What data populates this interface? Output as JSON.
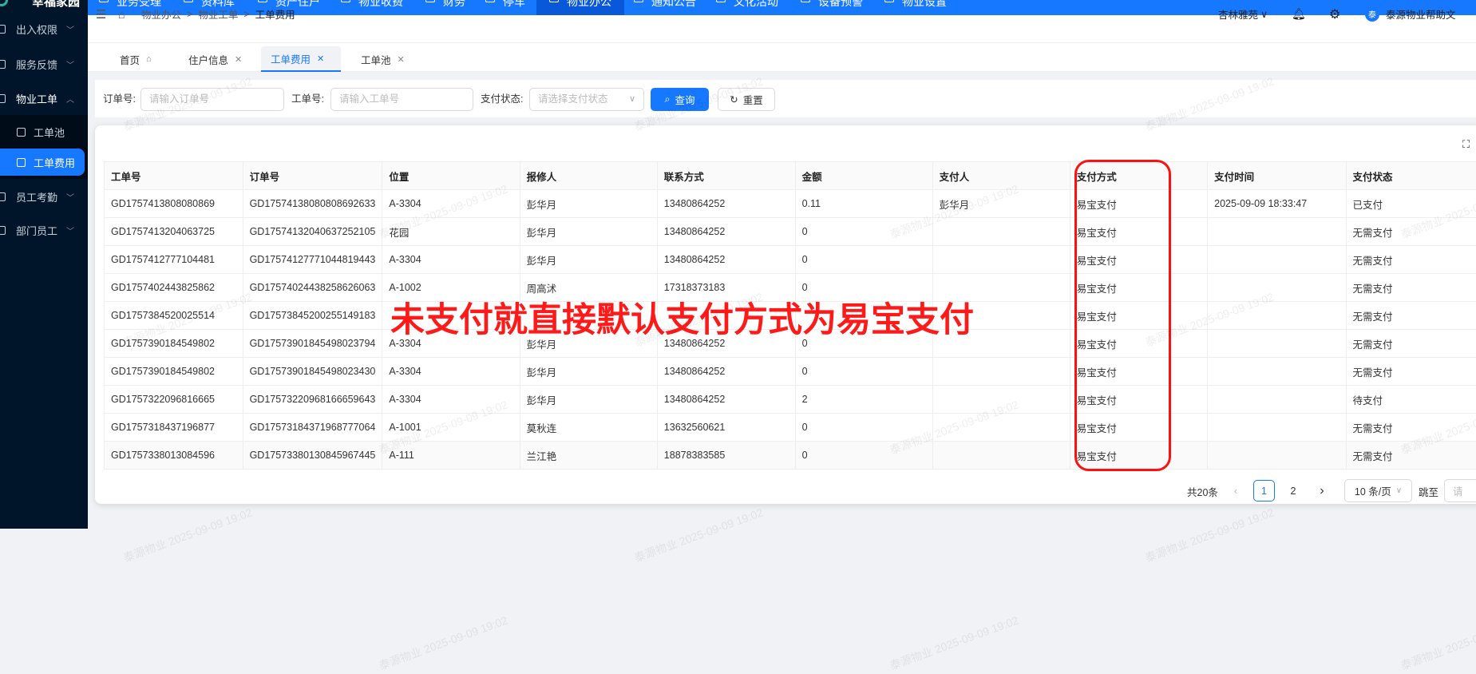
{
  "app": {
    "logo_text": "幸福家园"
  },
  "topnav": [
    {
      "label": "业务受理",
      "icon": "form-icon"
    },
    {
      "label": "资料库",
      "icon": "file-icon"
    },
    {
      "label": "资产住户",
      "icon": "bank-icon"
    },
    {
      "label": "物业收费",
      "icon": "money-icon"
    },
    {
      "label": "财务",
      "icon": "finance-icon"
    },
    {
      "label": "停车",
      "icon": "car-icon"
    },
    {
      "label": "物业办公",
      "icon": "office-icon",
      "active": true
    },
    {
      "label": "通知公告",
      "icon": "notice-icon"
    },
    {
      "label": "文化活动",
      "icon": "activity-icon"
    },
    {
      "label": "设备预警",
      "icon": "device-icon"
    },
    {
      "label": "物业设置",
      "icon": "setting-icon"
    }
  ],
  "sidebar": {
    "items": [
      {
        "label": "出入权限"
      },
      {
        "label": "服务反馈"
      },
      {
        "label": "物业工单"
      },
      {
        "label": "工单池"
      },
      {
        "label": "工单费用"
      },
      {
        "label": "员工考勤"
      },
      {
        "label": "部门员工"
      }
    ]
  },
  "breadcrumb": [
    "物业办公",
    "物业工单",
    "工单费用"
  ],
  "header": {
    "community": "杏林雅苑",
    "avatar_char": "泰",
    "user": "泰源物业",
    "help": "帮助文"
  },
  "tabs": [
    {
      "label": "首页"
    },
    {
      "label": "住户信息"
    },
    {
      "label": "工单费用",
      "active": true
    },
    {
      "label": "工单池"
    }
  ],
  "filter": {
    "order_label": "订单号:",
    "order_placeholder": "请输入订单号",
    "ticket_label": "工单号:",
    "ticket_placeholder": "请输入工单号",
    "status_label": "支付状态:",
    "status_placeholder": "请选择支付状态",
    "search": "查询",
    "reset": "重置"
  },
  "table": {
    "columns": [
      "工单号",
      "订单号",
      "位置",
      "报修人",
      "联系方式",
      "金额",
      "支付人",
      "支付方式",
      "支付时间",
      "支付状态"
    ],
    "rows": [
      [
        "GD1757413808080869",
        "GD17574138080808692633",
        "A-3304",
        "彭华月",
        "13480864252",
        "0.11",
        "彭华月",
        "易宝支付",
        "2025-09-09 18:33:47",
        "已支付"
      ],
      [
        "GD1757413204063725",
        "GD17574132040637252105",
        "花园",
        "彭华月",
        "13480864252",
        "0",
        "",
        "易宝支付",
        "",
        "无需支付"
      ],
      [
        "GD1757412777104481",
        "GD17574127771044819443",
        "A-3304",
        "彭华月",
        "13480864252",
        "0",
        "",
        "易宝支付",
        "",
        "无需支付"
      ],
      [
        "GD1757402443825862",
        "GD17574024438258626063",
        "A-1002",
        "周高沭",
        "17318373183",
        "0",
        "",
        "易宝支付",
        "",
        "无需支付"
      ],
      [
        "GD1757384520025514",
        "GD17573845200255149183",
        "",
        "",
        "",
        "",
        "",
        "易宝支付",
        "",
        "无需支付"
      ],
      [
        "GD1757390184549802",
        "GD17573901845498023794",
        "A-3304",
        "彭华月",
        "13480864252",
        "0",
        "",
        "易宝支付",
        "",
        "无需支付"
      ],
      [
        "GD1757390184549802",
        "GD17573901845498023430",
        "A-3304",
        "彭华月",
        "13480864252",
        "0",
        "",
        "易宝支付",
        "",
        "无需支付"
      ],
      [
        "GD1757322096816665",
        "GD17573220968166659643",
        "A-3304",
        "彭华月",
        "13480864252",
        "2",
        "",
        "易宝支付",
        "",
        "待支付"
      ],
      [
        "GD1757318437196877",
        "GD17573184371968777064",
        "A-1001",
        "莫秋连",
        "13632560621",
        "0",
        "",
        "易宝支付",
        "",
        "无需支付"
      ],
      [
        "GD1757338013084596",
        "GD17573380130845967445",
        "A-111",
        "兰江艳",
        "18878383585",
        "0",
        "",
        "易宝支付",
        "",
        "无需支付"
      ]
    ]
  },
  "pagination": {
    "total": "共20条",
    "pages": [
      "1",
      "2"
    ],
    "current": "1",
    "page_size": "10 条/页",
    "jump_label": "跳至",
    "jump_placeholder": "请"
  },
  "annotation": {
    "text": "未支付就直接默认支付方式为易宝支付",
    "color": "#ff1a1a"
  },
  "watermark": "泰源物业 2025-09-09 19:02",
  "colors": {
    "primary": "#1677ff",
    "sidebar": "#001529",
    "annotation": "#ff1a1a"
  }
}
